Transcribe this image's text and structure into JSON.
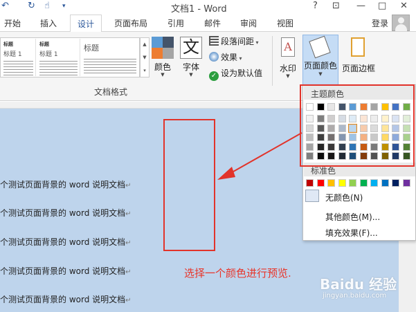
{
  "window": {
    "title": "文档1 - Word",
    "controls": [
      "?",
      "⊡",
      "—",
      "□",
      "✕"
    ]
  },
  "quick_access": [
    "undo-icon",
    "redo-icon",
    "touch-mode-icon",
    "customize-icon"
  ],
  "tabs": [
    {
      "label": "开始",
      "active": false
    },
    {
      "label": "插入",
      "active": false
    },
    {
      "label": "设计",
      "active": true
    },
    {
      "label": "页面布局",
      "active": false
    },
    {
      "label": "引用",
      "active": false
    },
    {
      "label": "邮件",
      "active": false
    },
    {
      "label": "审阅",
      "active": false
    },
    {
      "label": "视图",
      "active": false
    }
  ],
  "account": {
    "login_label": "登录"
  },
  "ribbon": {
    "style_gallery": [
      {
        "name": "标题",
        "heading": "标题 1"
      },
      {
        "name": "标题",
        "heading": "标题 1"
      },
      {
        "name": "标题",
        "heading": "标题"
      }
    ],
    "colors_label": "颜色",
    "fonts_label": "字体",
    "fonts_glyph": "文",
    "paragraph_spacing_label": "段落间距",
    "effects_label": "效果",
    "set_default_label": "设为默认值",
    "group_label": "文档格式",
    "watermark_label": "水印",
    "page_color_label": "页面颜色",
    "page_border_label": "页面边框"
  },
  "document": {
    "lines": [
      "个测试页面背景的 word 说明文档",
      "个测试页面背景的 word 说明文档",
      "个测试页面背景的 word 说明文档",
      "个测试页面背景的 word 说明文档",
      "个测试页面背景的 word 说明文档"
    ],
    "paragraph_mark": "↵",
    "page_color": "#bed4ec"
  },
  "annotation": {
    "caption": "选择一个颜色进行预览.",
    "color": "#e2332a"
  },
  "page_color_menu": {
    "theme_colors_header": "主题颜色",
    "standard_colors_header": "标准色",
    "theme_colors_top": [
      "#ffffff",
      "#000000",
      "#e7e6e6",
      "#44546a",
      "#5b9bd5",
      "#ed7d31",
      "#a5a5a5",
      "#ffc000",
      "#4472c4",
      "#70ad47"
    ],
    "theme_shades": [
      [
        "#f2f2f2",
        "#7f7f7f",
        "#d0cece",
        "#d6dce4",
        "#deebf6",
        "#fbe5d5",
        "#ededed",
        "#fff2cc",
        "#dae3f3",
        "#e2efd9"
      ],
      [
        "#d8d8d8",
        "#595959",
        "#aeabab",
        "#adb9ca",
        "#bdd7ee",
        "#f7cbac",
        "#dbdbdb",
        "#fee599",
        "#b4c6e7",
        "#c5e0b3"
      ],
      [
        "#bfbfbf",
        "#3f3f3f",
        "#757070",
        "#8496b0",
        "#9dc3e6",
        "#f4b183",
        "#c9c9c9",
        "#ffd965",
        "#8eaadb",
        "#a8d08d"
      ],
      [
        "#a5a5a5",
        "#262626",
        "#3a3838",
        "#323f4f",
        "#2e75b5",
        "#c55a11",
        "#7b7b7b",
        "#bf9000",
        "#2f5496",
        "#538135"
      ],
      [
        "#7f7f7f",
        "#0c0c0c",
        "#171616",
        "#222a35",
        "#1e4e79",
        "#833c0b",
        "#525252",
        "#7f6000",
        "#1f3864",
        "#375623"
      ]
    ],
    "selected_swatch": {
      "row": 1,
      "col": 4
    },
    "standard_colors": [
      "#c00000",
      "#ff0000",
      "#ffc000",
      "#ffff00",
      "#92d050",
      "#00b050",
      "#00b0f0",
      "#0070c0",
      "#002060",
      "#7030a0"
    ],
    "no_color_label": "无颜色(N)",
    "more_colors_label": "其他颜色(M)...",
    "fill_effects_label": "填充效果(F)..."
  },
  "watermark": {
    "text": "Baidu 经验",
    "url": "jingyan.baidu.com"
  }
}
